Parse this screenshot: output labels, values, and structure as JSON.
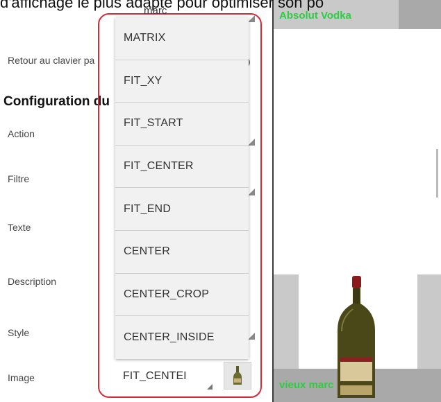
{
  "caption": {
    "text": "d'affichage le plus adapté pour optimiser son po",
    "sub": "marc"
  },
  "settings": {
    "return_label": "Retour au clavier pa",
    "section_title": "Configuration du",
    "rows": [
      "Action",
      "Filtre",
      "Texte",
      "Description",
      "Style",
      "Image"
    ]
  },
  "dropdown": {
    "options": [
      "MATRIX",
      "FIT_XY",
      "FIT_START",
      "FIT_CENTER",
      "FIT_END",
      "CENTER",
      "CENTER_CROP",
      "CENTER_INSIDE"
    ]
  },
  "image_spinner": {
    "value": "FIT_CENTEI",
    "thumbnail_icon": "bottle-icon"
  },
  "preview": {
    "top_text": "Absolut Vodka",
    "bottom_text": "vieux marc"
  },
  "colors": {
    "highlight": "#d22b3b",
    "overlay_text": "#2ecc40"
  }
}
